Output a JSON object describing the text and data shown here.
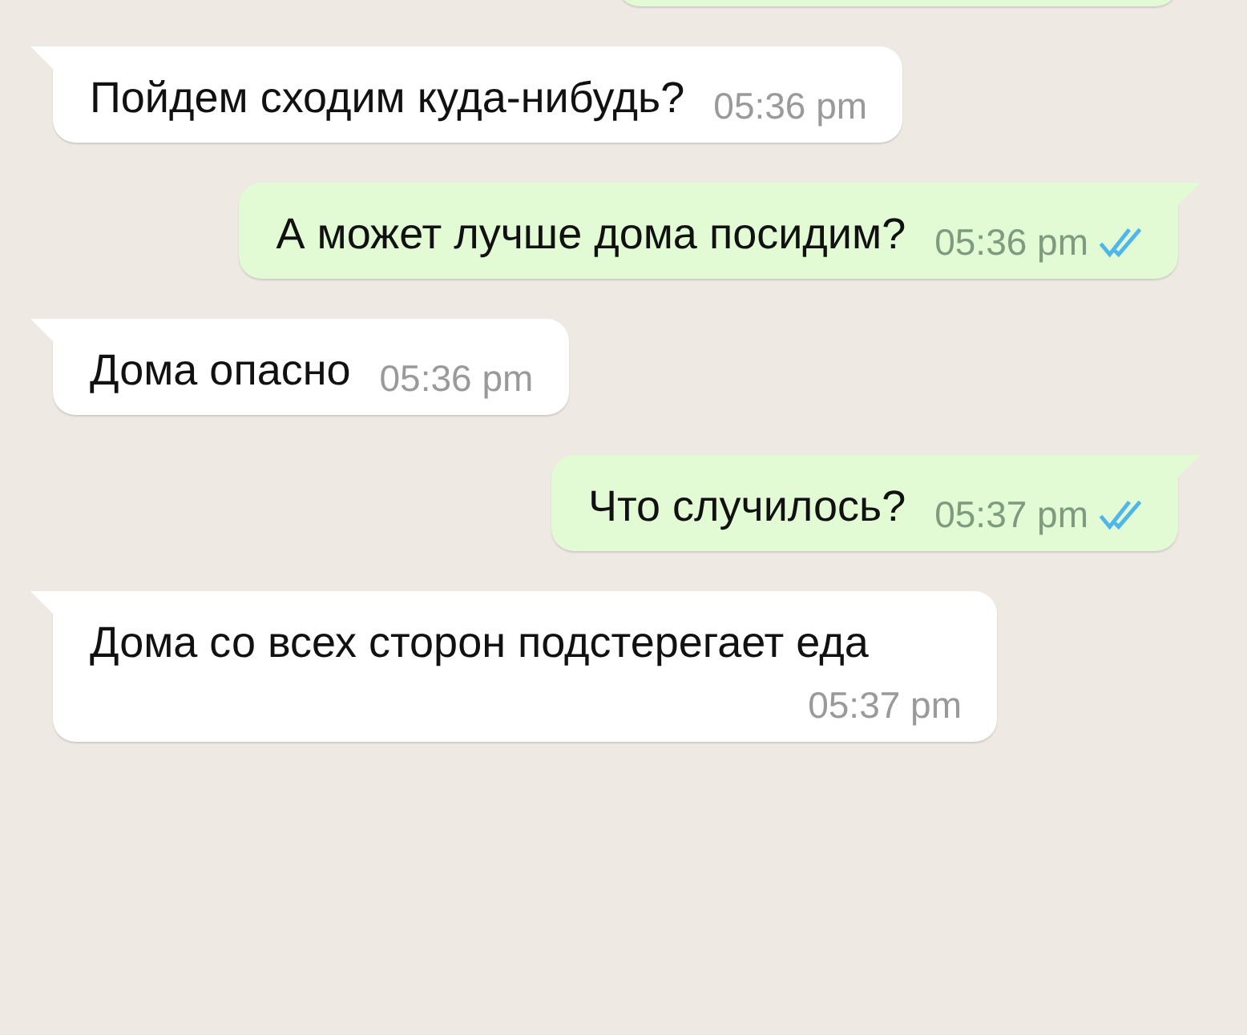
{
  "messages": [
    {
      "kind": "out",
      "cut_off": true
    },
    {
      "kind": "in",
      "text": "Пойдем сходим куда-нибудь?",
      "time": "05:36 pm"
    },
    {
      "kind": "out",
      "text": "А может лучше дома посидим?",
      "time": "05:36 pm",
      "read": true
    },
    {
      "kind": "in",
      "text": "Дома опасно",
      "time": "05:36 pm"
    },
    {
      "kind": "out",
      "text": "Что случилось?",
      "time": "05:37 pm",
      "read": true
    },
    {
      "kind": "in",
      "text": "Дома со всех сторон подстерегает еда",
      "time": "05:37 pm"
    }
  ]
}
